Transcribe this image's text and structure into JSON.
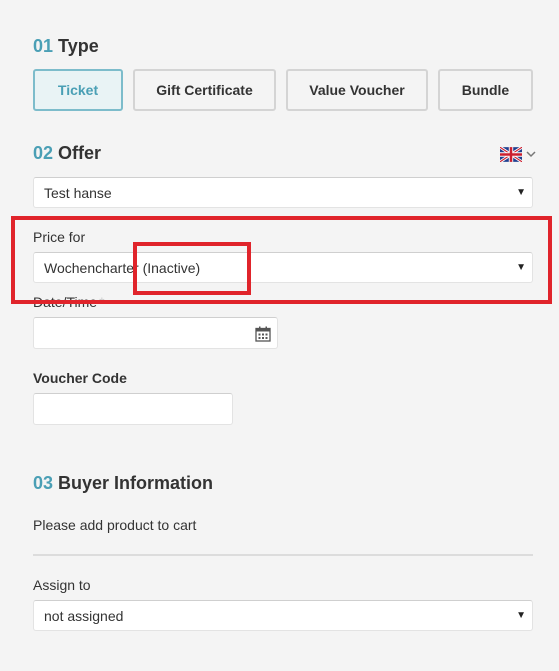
{
  "type_section": {
    "number": "01",
    "title": "Type",
    "buttons": [
      {
        "label": "Ticket",
        "active": true
      },
      {
        "label": "Gift Certificate",
        "active": false
      },
      {
        "label": "Value Voucher",
        "active": false
      },
      {
        "label": "Bundle",
        "active": false
      }
    ]
  },
  "offer_section": {
    "number": "02",
    "title": "Offer",
    "language_flag_icon": "uk-flag-icon",
    "offer_select": {
      "value": "Test hanse"
    },
    "price_for": {
      "label": "Price for",
      "value": "Wochencharter (Inactive)"
    },
    "date_time": {
      "label": "Date/Time",
      "required_marker": "*",
      "value": "",
      "icon": "calendar-icon"
    },
    "voucher_code": {
      "label": "Voucher Code",
      "value": ""
    }
  },
  "buyer_section": {
    "number": "03",
    "title": "Buyer Information",
    "message": "Please add product to cart",
    "assign_to": {
      "label": "Assign to",
      "value": "not assigned"
    }
  },
  "colors": {
    "accent": "#4a9fb5",
    "highlight": "#e0242b",
    "background": "#f4f4f4"
  }
}
